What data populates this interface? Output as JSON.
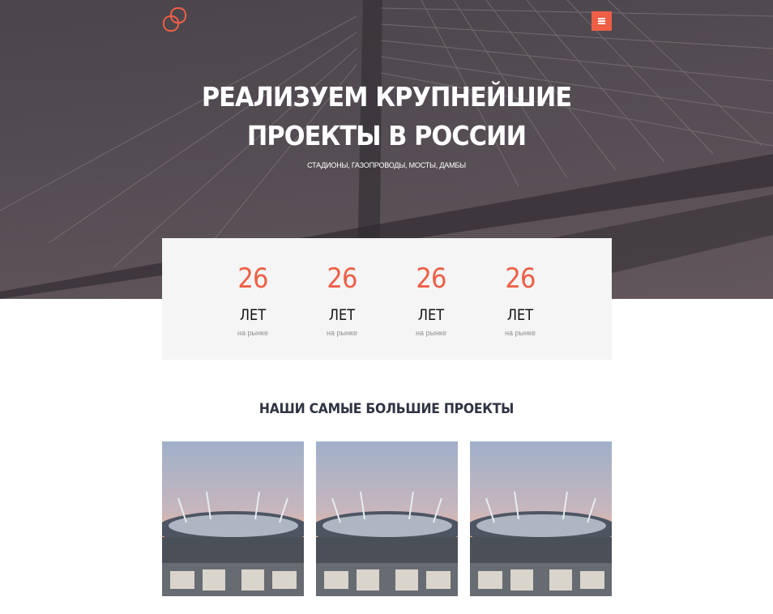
{
  "header": {
    "logo_icon": "linked-rings-logo-icon",
    "menu_icon": "hamburger-menu-icon",
    "accent_color": "#ee5f46"
  },
  "hero": {
    "title_line1": "РЕАЛИЗУЕМ КРУПНЕЙШИЕ",
    "title_line2": "ПРОЕКТЫ В РОССИИ",
    "subtitle": "СТАДИОНЫ, ГАЗОПРОВОДЫ, МОСТЫ, ДАМБЫ",
    "background": "cable-stayed bridge photo"
  },
  "stats": [
    {
      "number": "26",
      "label": "ЛЕТ",
      "caption": "на рынке"
    },
    {
      "number": "26",
      "label": "ЛЕТ",
      "caption": "на рынке"
    },
    {
      "number": "26",
      "label": "ЛЕТ",
      "caption": "на рынке"
    },
    {
      "number": "26",
      "label": "ЛЕТ",
      "caption": "на рынке"
    }
  ],
  "projects": {
    "title": "НАШИ САМЫЕ БОЛЬШИЕ ПРОЕКТЫ",
    "items": [
      {
        "image": "stadium photo"
      },
      {
        "image": "stadium photo"
      },
      {
        "image": "stadium photo"
      }
    ]
  }
}
